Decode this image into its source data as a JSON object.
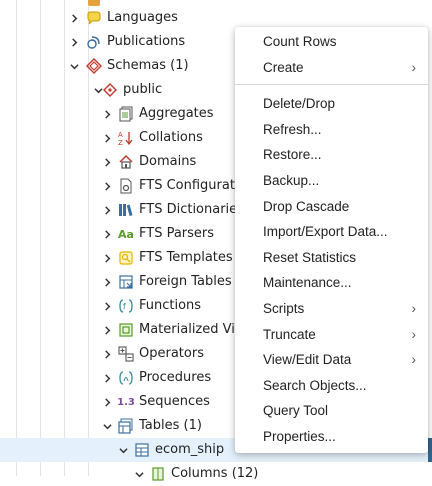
{
  "tree": {
    "rows": [
      {
        "label": "Languages",
        "caret": "›",
        "icon": "languages-icon"
      },
      {
        "label": "Publications",
        "caret": "›",
        "icon": "publications-icon"
      },
      {
        "label": "Schemas (1)",
        "caret": "⌄",
        "icon": "schemas-icon"
      },
      {
        "label": "public",
        "caret": "⌄",
        "icon": "schema-icon"
      },
      {
        "label": "Aggregates",
        "caret": "›",
        "icon": "aggregates-icon"
      },
      {
        "label": "Collations",
        "caret": "›",
        "icon": "collations-icon"
      },
      {
        "label": "Domains",
        "caret": "›",
        "icon": "domains-icon"
      },
      {
        "label": "FTS Configurations",
        "caret": "›",
        "icon": "fts-configurations-icon"
      },
      {
        "label": "FTS Dictionaries",
        "caret": "›",
        "icon": "fts-dictionaries-icon"
      },
      {
        "label": "FTS Parsers",
        "caret": "›",
        "icon": "fts-parsers-icon",
        "icon_text": "Aa"
      },
      {
        "label": "FTS Templates",
        "caret": "›",
        "icon": "fts-templates-icon"
      },
      {
        "label": "Foreign Tables",
        "caret": "›",
        "icon": "foreign-tables-icon"
      },
      {
        "label": "Functions",
        "caret": "›",
        "icon": "functions-icon"
      },
      {
        "label": "Materialized Views",
        "caret": "›",
        "icon": "materialized-views-icon"
      },
      {
        "label": "Operators",
        "caret": "›",
        "icon": "operators-icon"
      },
      {
        "label": "Procedures",
        "caret": "›",
        "icon": "procedures-icon"
      },
      {
        "label": "Sequences",
        "caret": "›",
        "icon": "sequences-icon",
        "icon_text": "1.3"
      },
      {
        "label": "Tables (1)",
        "caret": "⌄",
        "icon": "tables-icon"
      },
      {
        "label": "ecom_ship",
        "caret": "⌄",
        "icon": "table-icon"
      },
      {
        "label": "Columns (12)",
        "caret": "⌄",
        "icon": "columns-icon"
      }
    ]
  },
  "context_menu": {
    "items": [
      {
        "label": "Count Rows",
        "submenu": false
      },
      {
        "label": "Create",
        "submenu": true
      },
      {
        "separator": true
      },
      {
        "label": "Delete/Drop",
        "submenu": false
      },
      {
        "label": "Refresh...",
        "submenu": false
      },
      {
        "label": "Restore...",
        "submenu": false
      },
      {
        "label": "Backup...",
        "submenu": false
      },
      {
        "label": "Drop Cascade",
        "submenu": false
      },
      {
        "label": "Import/Export Data...",
        "submenu": false
      },
      {
        "label": "Reset Statistics",
        "submenu": false
      },
      {
        "label": "Maintenance...",
        "submenu": false
      },
      {
        "label": "Scripts",
        "submenu": true
      },
      {
        "label": "Truncate",
        "submenu": true
      },
      {
        "label": "View/Edit Data",
        "submenu": true
      },
      {
        "label": "Search Objects...",
        "submenu": false
      },
      {
        "label": "Query Tool",
        "submenu": false
      },
      {
        "label": "Properties...",
        "submenu": false
      }
    ],
    "submenu_glyph": "›"
  },
  "colors": {
    "selected_row": "#e4f0fb",
    "accent": "#326690",
    "icon_blue": "#3b6e9a",
    "icon_red": "#c0392b",
    "icon_green": "#5a9a2c",
    "icon_yellow": "#e6b400",
    "icon_purple": "#7b4fa0"
  }
}
